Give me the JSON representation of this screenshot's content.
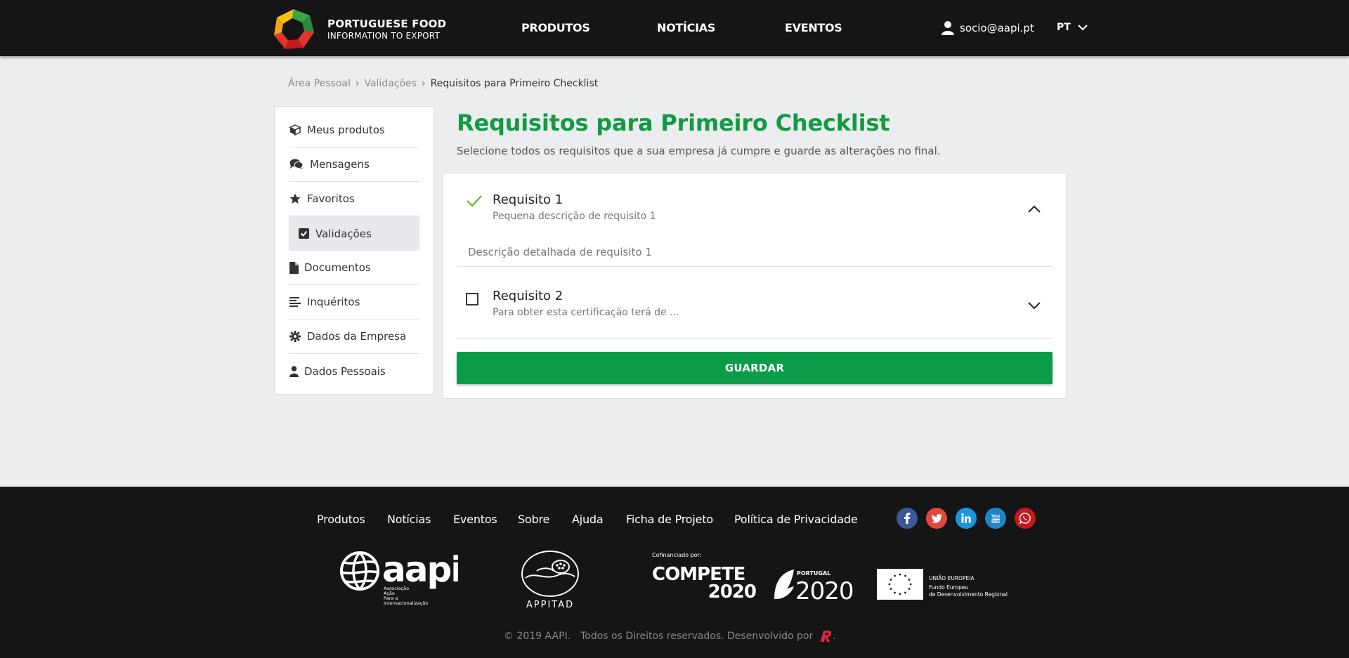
{
  "header": {
    "brand_line1": "PORTUGUESE FOOD",
    "brand_line2": "INFORMATION TO EXPORT",
    "nav": [
      "PRODUTOS",
      "NOTÍCIAS",
      "EVENTOS"
    ],
    "user_email": "socio@aapi.pt",
    "language": "PT"
  },
  "breadcrumb": {
    "items": [
      "Área Pessoal",
      "Validações",
      "Requisitos para Primeiro Checklist"
    ]
  },
  "sidebar": {
    "items": [
      {
        "label": "Meus produtos",
        "icon": "box-icon"
      },
      {
        "label": "Mensagens",
        "icon": "comments-icon"
      },
      {
        "label": "Favoritos",
        "icon": "star-icon"
      },
      {
        "label": "Validações",
        "icon": "check-square-icon",
        "active": true
      },
      {
        "label": "Documentos",
        "icon": "file-icon"
      },
      {
        "label": "Inquéritos",
        "icon": "align-left-icon"
      },
      {
        "label": "Dados da Empresa",
        "icon": "gear-icon"
      },
      {
        "label": "Dados Pessoais",
        "icon": "user-icon"
      }
    ]
  },
  "main": {
    "title": "Requisitos para Primeiro Checklist",
    "subtitle": "Selecione todos os requisitos que a sua empresa já cumpre e guarde as alterações no final.",
    "requirements": [
      {
        "title": "Requisito 1",
        "short_desc": "Pequena descrição de requisito 1",
        "detail": "Descrição detalhada de requisito 1",
        "checked": true,
        "expanded": true
      },
      {
        "title": "Requisito 2",
        "short_desc": "Para obter esta certificação terá de ...",
        "checked": false,
        "expanded": false
      }
    ],
    "save_label": "GUARDAR"
  },
  "footer": {
    "links": [
      "Produtos",
      "Notícias",
      "Eventos",
      "Sobre",
      "Ajuda",
      "Ficha de Projeto",
      "Política de Privacidade"
    ],
    "social": [
      {
        "name": "facebook-icon",
        "color": "#3b5998"
      },
      {
        "name": "twitter-icon",
        "color": "#e0483b"
      },
      {
        "name": "linkedin-icon",
        "color": "#1c95e0"
      },
      {
        "name": "youtube-icon",
        "color": "#1c86c7"
      },
      {
        "name": "whatsapp-icon",
        "color": "#c8171e"
      }
    ],
    "partners": {
      "aapi_name": "aapi",
      "aapi_tagline": [
        "Associação",
        "Ação",
        "Para a",
        "Internacionalização"
      ],
      "appitad_name": "APPITAD",
      "cofinanced_label": "Cofinanciado por:",
      "compete_word": "COMPETE",
      "compete_year": "2020",
      "portugal_label": "PORTUGAL",
      "portugal_year": "2020",
      "eu_line1": "UNIÃO EUROPEIA",
      "eu_line2": "Fundo Europeu",
      "eu_line3": "de Desenvolvimento Regional"
    },
    "copyright": "© 2019 AAPI.",
    "rights": "Todos os Direitos reservados. Desenvolvido por",
    "end_period": "."
  },
  "colors": {
    "accent_green": "#139a43",
    "button_green": "#0a9c48",
    "header_bg": "#151515",
    "page_bg": "#ebedef"
  }
}
